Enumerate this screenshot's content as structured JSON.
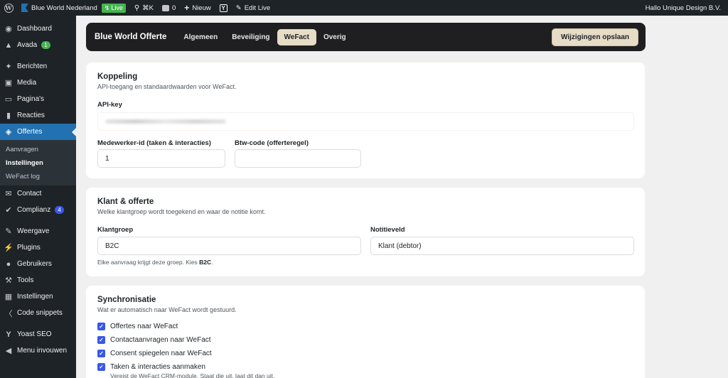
{
  "adminbar": {
    "site_name": "Blue World Nederland",
    "live_label": "Live",
    "shortcut": "⌘K",
    "comments_count": "0",
    "new_label": "Nieuw",
    "edit_live": "Edit Live",
    "greeting": "Hallo Unique Design B.V."
  },
  "sidebar": {
    "items": [
      {
        "label": "Dashboard",
        "icon": "dashboard-icon"
      },
      {
        "label": "Avada",
        "icon": "avada-icon",
        "badge": "1"
      },
      {
        "label": "Berichten",
        "icon": "pin-icon"
      },
      {
        "label": "Media",
        "icon": "media-icon"
      },
      {
        "label": "Pagina's",
        "icon": "page-icon"
      },
      {
        "label": "Reacties",
        "icon": "comment-icon"
      },
      {
        "label": "Offertes",
        "icon": "tag-icon"
      },
      {
        "label": "Contact",
        "icon": "mail-icon"
      },
      {
        "label": "Complianz",
        "icon": "check-icon",
        "badge": "4"
      },
      {
        "label": "Weergave",
        "icon": "brush-icon"
      },
      {
        "label": "Plugins",
        "icon": "plug-icon"
      },
      {
        "label": "Gebruikers",
        "icon": "user-icon"
      },
      {
        "label": "Tools",
        "icon": "wrench-icon"
      },
      {
        "label": "Instellingen",
        "icon": "settings-icon"
      },
      {
        "label": "Code snippets",
        "icon": "code-icon"
      },
      {
        "label": "Yoast SEO",
        "icon": "yoast-icon"
      },
      {
        "label": "Menu invouwen",
        "icon": "collapse-icon"
      }
    ],
    "submenu": [
      {
        "label": "Aanvragen"
      },
      {
        "label": "Instellingen"
      },
      {
        "label": "WeFact log"
      }
    ]
  },
  "topbar": {
    "title": "Blue World Offerte",
    "tabs": [
      {
        "label": "Algemeen"
      },
      {
        "label": "Beveiliging"
      },
      {
        "label": "WeFact"
      },
      {
        "label": "Overig"
      }
    ],
    "save_label": "Wijzigingen opslaan"
  },
  "koppeling": {
    "title": "Koppeling",
    "subtitle": "API-toegang en standaardwaarden voor WeFact.",
    "api_key_label": "API-key",
    "employee_label": "Medewerker-id (taken & interacties)",
    "employee_value": "1",
    "vat_label": "Btw-code (offerteregel)",
    "vat_value": ""
  },
  "klant": {
    "title": "Klant & offerte",
    "subtitle": "Welke klantgroep wordt toegekend en waar de notitie komt.",
    "group_label": "Klantgroep",
    "group_value": "B2C",
    "note_label": "Notitieveld",
    "note_value": "Klant (debtor)",
    "hint_prefix": "Elke aanvraag krijgt deze groep. Kies ",
    "hint_bold": "B2C",
    "hint_suffix": "."
  },
  "sync": {
    "title": "Synchronisatie",
    "subtitle": "Wat er automatisch naar WeFact wordt gestuurd.",
    "items": [
      {
        "label": "Offertes naar WeFact"
      },
      {
        "label": "Contactaanvragen naar WeFact"
      },
      {
        "label": "Consent spiegelen naar WeFact"
      },
      {
        "label": "Taken & interacties aanmaken"
      }
    ],
    "footnote": "Vereist de WeFact CRM-module. Staat die uit, laat dit dan uit."
  }
}
